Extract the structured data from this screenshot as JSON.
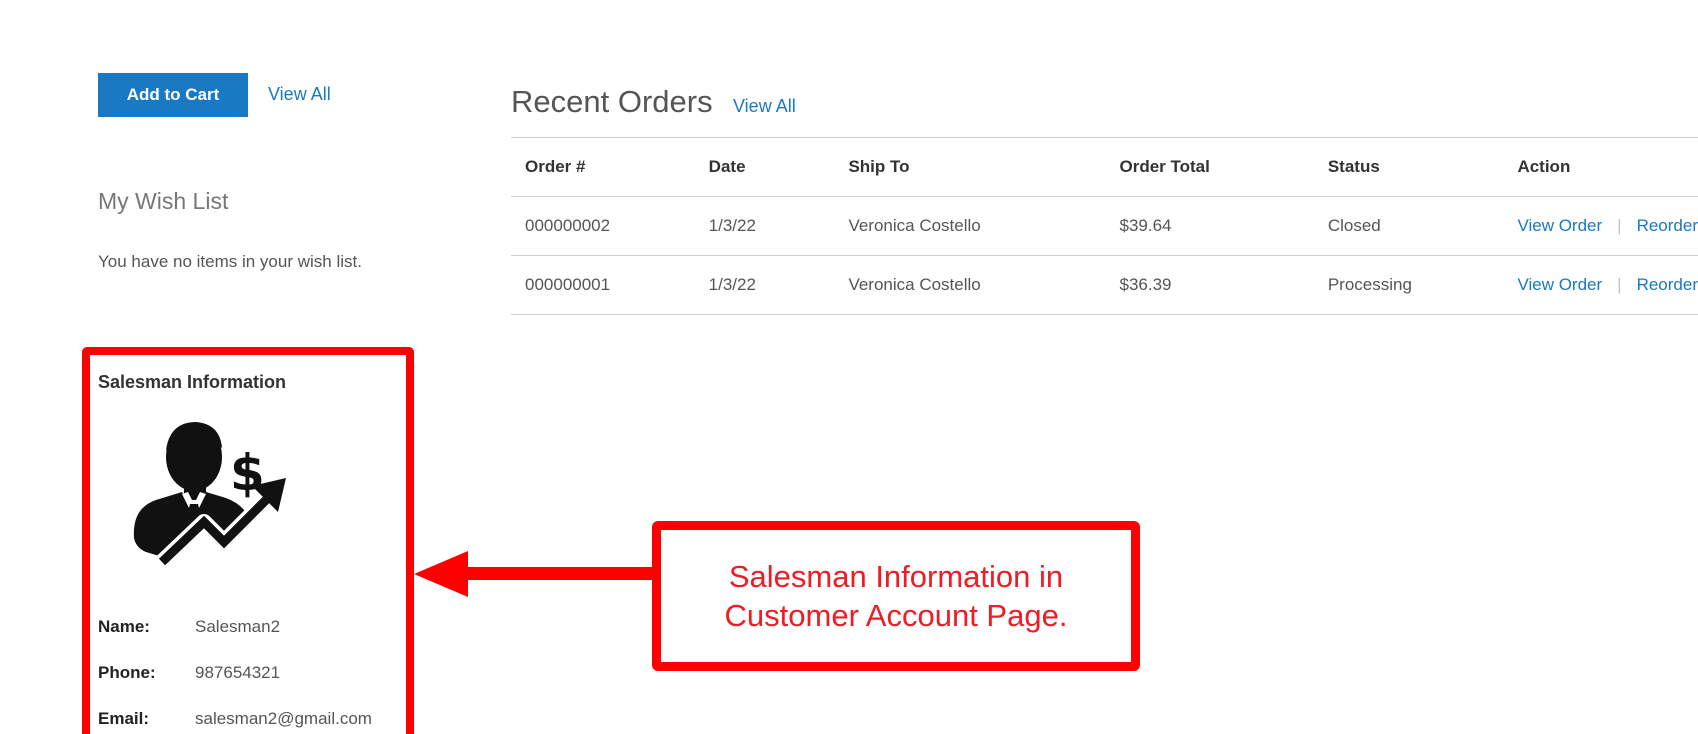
{
  "wishlist_section": {
    "add_to_cart_label": "Add to Cart",
    "view_all_label": "View All",
    "title": "My Wish List",
    "empty_message": "You have no items in your wish list."
  },
  "recent_orders": {
    "title": "Recent Orders",
    "view_all_label": "View All",
    "columns": [
      "Order #",
      "Date",
      "Ship To",
      "Order Total",
      "Status",
      "Action"
    ],
    "rows": [
      {
        "order_number": "000000002",
        "date": "1/3/22",
        "ship_to": "Veronica Costello",
        "order_total": "$39.64",
        "status": "Closed",
        "view_order_label": "View Order",
        "separator": "|",
        "reorder_label": "Reorder"
      },
      {
        "order_number": "000000001",
        "date": "1/3/22",
        "ship_to": "Veronica Costello",
        "order_total": "$36.39",
        "status": "Processing",
        "view_order_label": "View Order",
        "separator": "|",
        "reorder_label": "Reorder"
      }
    ]
  },
  "salesman": {
    "title": "Salesman Information",
    "avatar_icon": "salesman-dollar-growth-icon",
    "name_label": "Name:",
    "name": "Salesman2",
    "phone_label": "Phone:",
    "phone": "987654321",
    "email_label": "Email:",
    "email": "salesman2@gmail.com"
  },
  "annotation": {
    "line1": "Salesman Information in",
    "line2": "Customer Account Page.",
    "color": "#ff0000"
  },
  "colors": {
    "link": "#1979c3",
    "button": "#1979c3",
    "highlight": "#ff0000"
  }
}
